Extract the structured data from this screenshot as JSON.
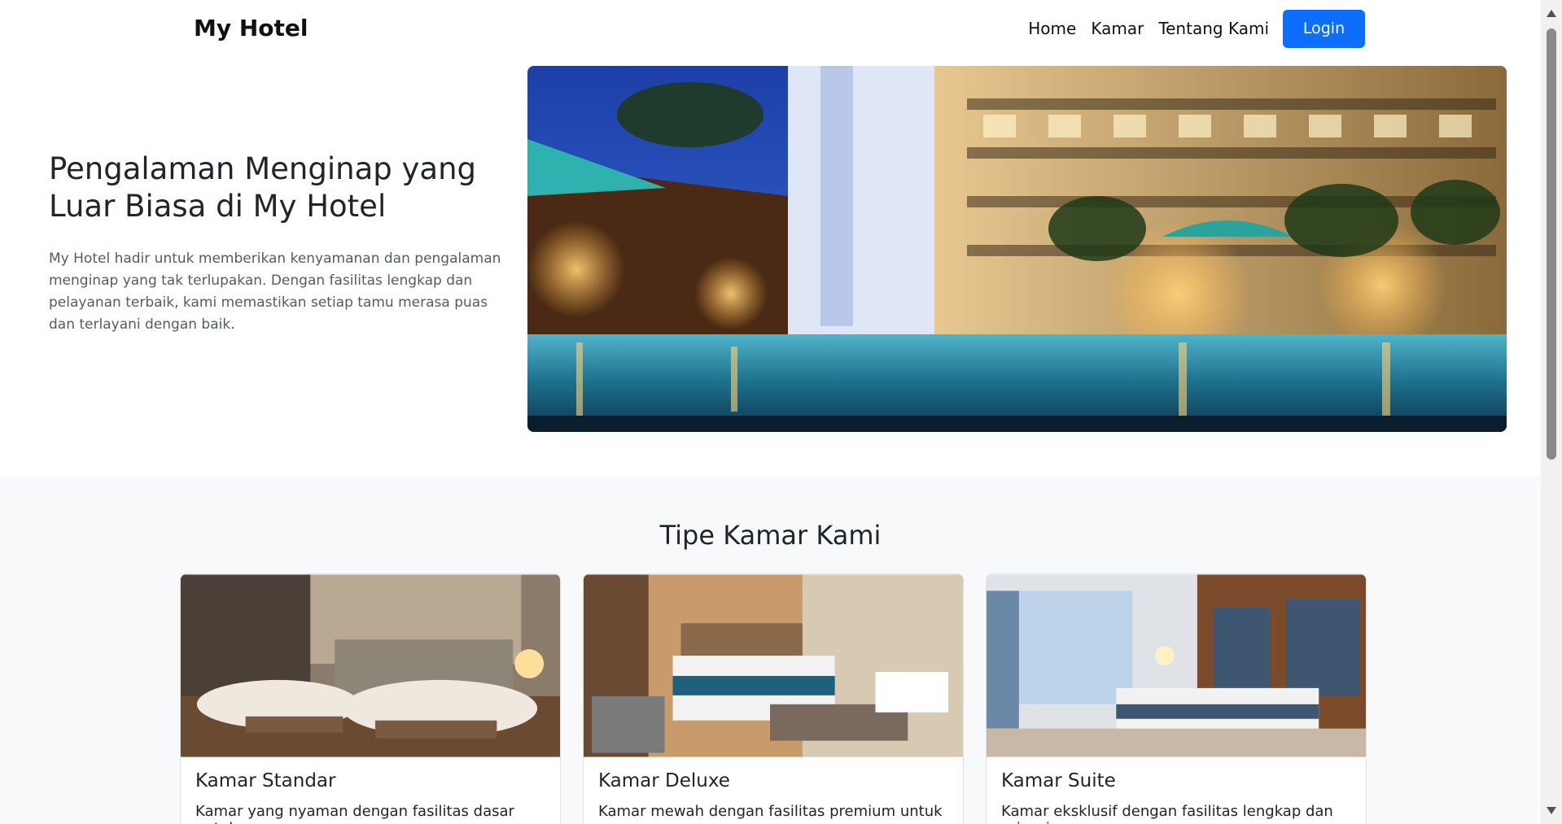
{
  "navbar": {
    "brand": "My Hotel",
    "links": [
      "Home",
      "Kamar",
      "Tentang Kami"
    ],
    "login_label": "Login"
  },
  "hero": {
    "title": "Pengalaman Menginap yang Luar Biasa di My Hotel",
    "description": "My Hotel hadir untuk memberikan kenyamanan dan pengalaman menginap yang tak terlupakan. Dengan fasilitas lengkap dan pelayanan terbaik, kami memastikan setiap tamu merasa puas dan terlayani dengan baik."
  },
  "rooms": {
    "title": "Tipe Kamar Kami",
    "cards": [
      {
        "title": "Kamar Standar",
        "text": "Kamar yang nyaman dengan fasilitas dasar untuk"
      },
      {
        "title": "Kamar Deluxe",
        "text": "Kamar mewah dengan fasilitas premium untuk"
      },
      {
        "title": "Kamar Suite",
        "text": "Kamar eksklusif dengan fasilitas lengkap dan privasi"
      }
    ]
  },
  "colors": {
    "primary": "#0d6efd",
    "section_bg": "#f8f9fa"
  }
}
